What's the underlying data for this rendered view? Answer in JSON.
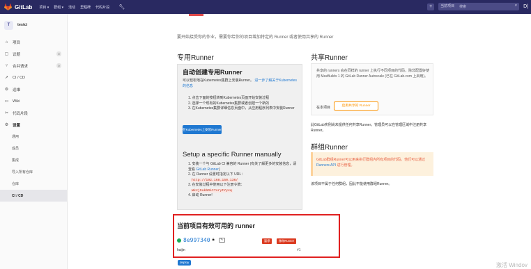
{
  "topbar": {
    "brand": "GitLab",
    "nav": [
      "项目 ▾",
      "群组 ▾",
      "活动",
      "里程碑",
      "代码片段"
    ],
    "scope": "当前项目",
    "search_placeholder": "搜索"
  },
  "sidebar": {
    "project_initial": "T",
    "project_name": "testci",
    "items": [
      {
        "label": "项目",
        "icon": "home-icon"
      },
      {
        "label": "议题",
        "icon": "issues-icon",
        "count": "0"
      },
      {
        "label": "合并请求",
        "icon": "merge-request-icon",
        "count": "0"
      },
      {
        "label": "CI / CD",
        "icon": "rocket-icon"
      },
      {
        "label": "运维",
        "icon": "operations-icon"
      },
      {
        "label": "Wiki",
        "icon": "book-icon"
      },
      {
        "label": "代码片段",
        "icon": "snippet-icon"
      },
      {
        "label": "设置",
        "icon": "gear-icon"
      }
    ],
    "settings_sub": [
      "通用",
      "成员",
      "集成",
      "导入所有仓库",
      "仓库",
      "CI / CD"
    ]
  },
  "content": {
    "intro": "要开始接受你的作业，需要你给你的项目增加特定的 Runner 或者使用共享的 Runner",
    "specific_heading": "专用Runner",
    "shared_heading": "共享Runner",
    "auto_title": "自动创建专用Runner",
    "auto_desc": "可以轻松地在Kubernetes集群上安装Runner。",
    "auto_link": "进一步了解关于Kubernetes的信息",
    "auto_steps": [
      "1. 点击下面的按钮转到Kubernetes页面开始安装过程",
      "2. 选择一个现有的Kubernetes集群或者创建一个新的",
      "3. 在Kubernetes集群详细信息页面中，从应用程序列表中安装Runner"
    ],
    "install_button": "在Kubernetes上安装Runner",
    "manual_title": "Setup a specific Runner manually",
    "manual_step1": "1. 安装一个与 GitLab CI 兼容的 Runner (有关了解更多的安装信息，请查看 ",
    "manual_step1_link": "GitLab Runner",
    "manual_step1_end": ")",
    "manual_step2": "2. 在 Runner 设置时指定以下 URL：",
    "manual_url": "http://192.168.150.136/",
    "manual_step3": "3. 在安装过程中使用以下注册令牌：",
    "manual_token": "WkJjSukbDitYxrytYyxq",
    "manual_step4": "4. 启动 Runner!",
    "shared_desc": "共享的 runners 会在同样的 runner 上执行不同项目的代码，除非配置好使用 MaxBuilds 1 的 GitLab Runner Autoscale (已在 GitLab.com 上启用)。",
    "shared_label": "在本项目",
    "shared_button": "启用共享的 Runner",
    "shared_note": "此GitLab实例尚未提供任何共享Runner。管理员可以在管理区域中注册共享Runner。",
    "group_heading": "群组Runner",
    "group_desc": "GitLab群组Runner可以用来执行群组内所有项目的代码。他们可以通过 ",
    "group_link": "Runners API",
    "group_desc_end": " 进行管理。",
    "group_note": "该项目不属于任何群组，因此不能使用群组Runner。"
  },
  "available": {
    "title": "当前项目有效可用的 runner",
    "runner_id": "8e997340",
    "pause_button": "暂停",
    "remove_button": "移除Runner",
    "description": "haijin",
    "number": "#1",
    "tag": "deploy"
  },
  "watermark": "激活 Windov",
  "colors": {
    "navbar": "#292961",
    "link": "#1f78d1",
    "danger": "#db3b21",
    "warning": "#fc9403",
    "success": "#1aaa55",
    "highlight_border": "#e02020"
  }
}
